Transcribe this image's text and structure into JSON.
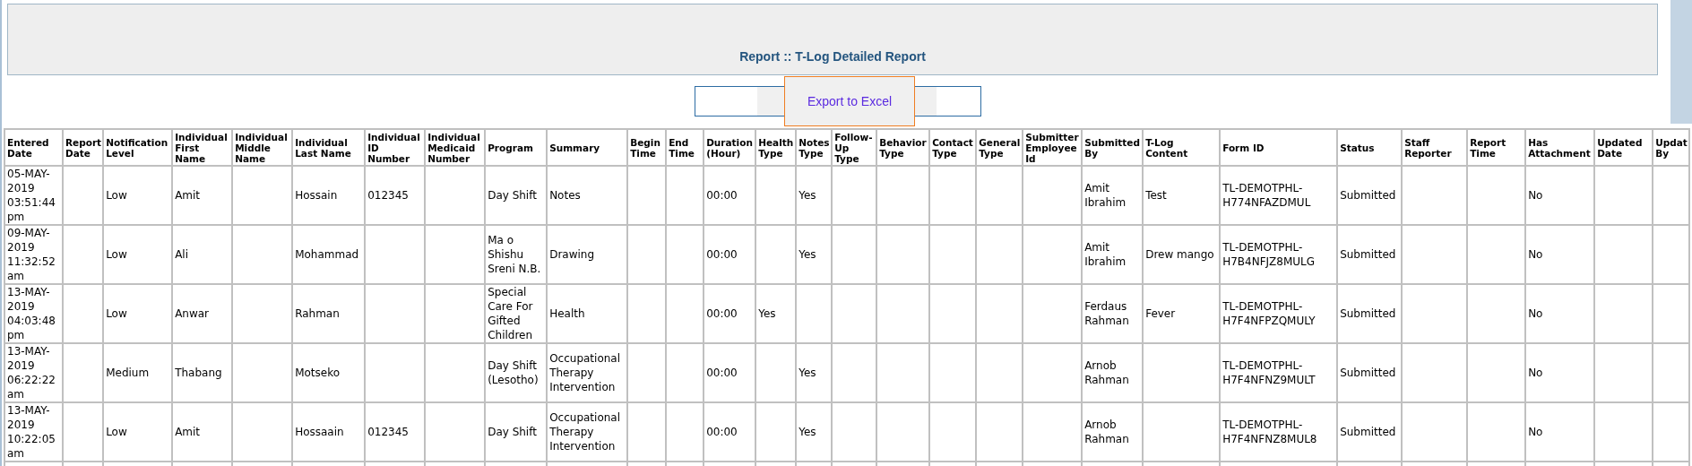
{
  "header": {
    "title": "Report :: T-Log Detailed Report"
  },
  "export_button": {
    "label": "Export to Excel"
  },
  "table": {
    "columns": [
      "Entered Date",
      "Report Date",
      "Notification Level",
      "Individual First Name",
      "Individual Middle Name",
      "Individual Last Name",
      "Individual ID Number",
      "Individual Medicaid Number",
      "Program",
      "Summary",
      "Begin Time",
      "End Time",
      "Duration (Hour)",
      "Health Type",
      "Notes Type",
      "Follow-Up Type",
      "Behavior Type",
      "Contact Type",
      "General Type",
      "Submitter Employee Id",
      "Submitted By",
      "T-Log Content",
      "Form ID",
      "Status",
      "Staff Reporter",
      "Report Time",
      "Has Attachment",
      "Updated Date",
      "Updat By"
    ],
    "rows": [
      [
        "05-MAY-2019 03:51:44 pm",
        null,
        "Low",
        "Amit",
        null,
        "Hossain",
        "012345",
        null,
        "Day Shift",
        "Notes",
        null,
        null,
        "00:00",
        null,
        "Yes",
        null,
        null,
        null,
        null,
        null,
        "Amit Ibrahim",
        "Test",
        "TL-DEMOTPHL-H774NFAZDMUL",
        "Submitted",
        null,
        null,
        "No",
        null,
        null
      ],
      [
        "09-MAY-2019 11:32:52 am",
        null,
        "Low",
        "Ali",
        null,
        "Mohammad",
        null,
        null,
        "Ma o Shishu Sreni N.B.",
        "Drawing",
        null,
        null,
        "00:00",
        null,
        "Yes",
        null,
        null,
        null,
        null,
        null,
        "Amit Ibrahim",
        "Drew mango",
        "TL-DEMOTPHL-H7B4NFJZ8MULG",
        "Submitted",
        null,
        null,
        "No",
        null,
        null
      ],
      [
        "13-MAY-2019 04:03:48 pm",
        null,
        "Low",
        "Anwar",
        null,
        "Rahman",
        null,
        null,
        "Special Care For Gifted Children",
        "Health",
        null,
        null,
        "00:00",
        "Yes",
        null,
        null,
        null,
        null,
        null,
        null,
        "Ferdaus Rahman",
        "Fever",
        "TL-DEMOTPHL-H7F4NFPZQMULY",
        "Submitted",
        null,
        null,
        "No",
        null,
        null
      ],
      [
        "13-MAY-2019 06:22:22 am",
        null,
        "Medium",
        "Thabang",
        null,
        "Motseko",
        null,
        null,
        "Day Shift (Lesotho)",
        "Occupational Therapy Intervention",
        null,
        null,
        "00:00",
        null,
        "Yes",
        null,
        null,
        null,
        null,
        null,
        "Arnob Rahman",
        null,
        "TL-DEMOTPHL-H7F4NFNZ9MULT",
        "Submitted",
        null,
        null,
        "No",
        null,
        null
      ],
      [
        "13-MAY-2019 10:22:05 am",
        null,
        "Low",
        "Amit",
        null,
        "Hossaain",
        "012345",
        null,
        "Day Shift",
        "Occupational Therapy Intervention",
        null,
        null,
        "00:00",
        null,
        "Yes",
        null,
        null,
        null,
        null,
        null,
        "Arnob Rahman",
        null,
        "TL-DEMOTPHL-H7F4NFNZ8MUL8",
        "Submitted",
        null,
        null,
        "No",
        null,
        null
      ]
    ]
  }
}
